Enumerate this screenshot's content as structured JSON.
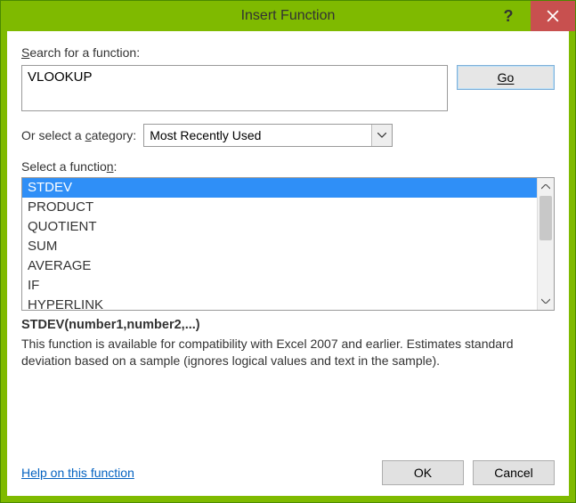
{
  "titlebar": {
    "title": "Insert Function",
    "help_tooltip": "Help",
    "close_tooltip": "Close"
  },
  "search": {
    "label_pre": "S",
    "label_post": "earch for a function:",
    "value": "VLOOKUP",
    "go_label": "Go"
  },
  "category": {
    "label_pre": "Or select a ",
    "label_accel": "c",
    "label_post": "ategory:",
    "selected": "Most Recently Used"
  },
  "function_list": {
    "label_pre": "Select a functio",
    "label_accel": "n",
    "label_post": ":",
    "items": [
      "STDEV",
      "PRODUCT",
      "QUOTIENT",
      "SUM",
      "AVERAGE",
      "IF",
      "HYPERLINK"
    ],
    "selected_index": 0
  },
  "details": {
    "signature": "STDEV(number1,number2,...)",
    "description": "This function is available for compatibility with Excel 2007 and earlier. Estimates standard deviation based on a sample (ignores logical values and text in the sample)."
  },
  "footer": {
    "help_link": "Help on this function",
    "ok": "OK",
    "cancel": "Cancel"
  }
}
